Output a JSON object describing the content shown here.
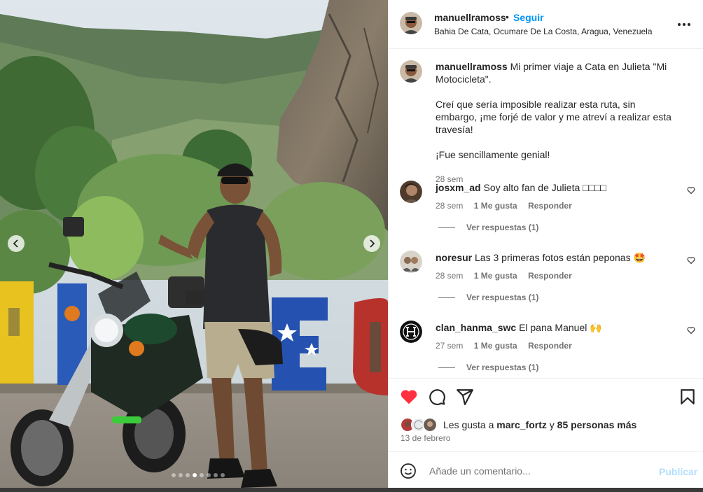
{
  "post": {
    "username": "manuellramoss",
    "separator": "•",
    "follow_label": "Seguir",
    "location": "Bahia De Cata, Ocumare De La Costa, Aragua, Venezuela",
    "more_label": "•••"
  },
  "caption": {
    "username": "manuellramoss",
    "text_1": "Mi primer viaje a Cata en Julieta \"Mi Motocicleta\".",
    "text_2": "Creí que sería imposible realizar esta ruta, sin embargo, ¡me forjé de valor y me atreví a realizar esta travesía!",
    "text_3": "¡Fue sencillamente genial!",
    "time": "28 sem"
  },
  "comments": [
    {
      "username": "josxm_ad",
      "text": "Soy alto fan de Julieta □□□□",
      "time": "28 sem",
      "likes": "1 Me gusta",
      "reply_label": "Responder",
      "view_replies": "Ver respuestas (1)"
    },
    {
      "username": "noresur",
      "text": "Las 3 primeras fotos están peponas 🤩",
      "time": "28 sem",
      "likes": "1 Me gusta",
      "reply_label": "Responder",
      "view_replies": "Ver respuestas (1)"
    },
    {
      "username": "clan_hanma_swc",
      "text": "El pana Manuel 🙌",
      "time": "27 sem",
      "likes": "1 Me gusta",
      "reply_label": "Responder",
      "view_replies": "Ver respuestas (1)"
    }
  ],
  "likes": {
    "prefix": "Les gusta a",
    "user": "marc_fortz",
    "conj": "y",
    "others": "85 personas más",
    "date": "13 de febrero"
  },
  "add_comment": {
    "placeholder": "Añade un comentario...",
    "post_label": "Publicar"
  },
  "carousel": {
    "slide_count": 8,
    "active_index": 3
  },
  "colors": {
    "accent": "#0095f6",
    "like_red": "#ff3040",
    "muted": "#737373",
    "post_disabled": "#b2dffc"
  },
  "icons": [
    "chevron-left-icon",
    "chevron-right-icon",
    "more-icon",
    "heart-icon",
    "comment-icon",
    "share-icon",
    "bookmark-icon",
    "emoji-icon"
  ]
}
